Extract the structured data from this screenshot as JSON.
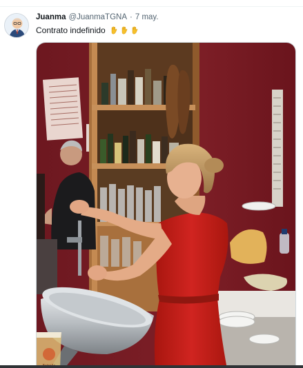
{
  "tweet": {
    "author_name": "Juanma",
    "handle": "@JuanmaTGNA",
    "separator": "·",
    "date": "7 may.",
    "text": "Contrato indefinido",
    "emojis": [
      "clap-hand-emoji",
      "clap-hand-emoji",
      "clap-hand-emoji"
    ]
  },
  "media": {
    "cup_label": "Estrella"
  },
  "colors": {
    "name": "#0f1419",
    "meta": "#536471",
    "wall": "#7a1c24",
    "dress": "#c81d1a",
    "shelf_wood": "#b07a45"
  }
}
